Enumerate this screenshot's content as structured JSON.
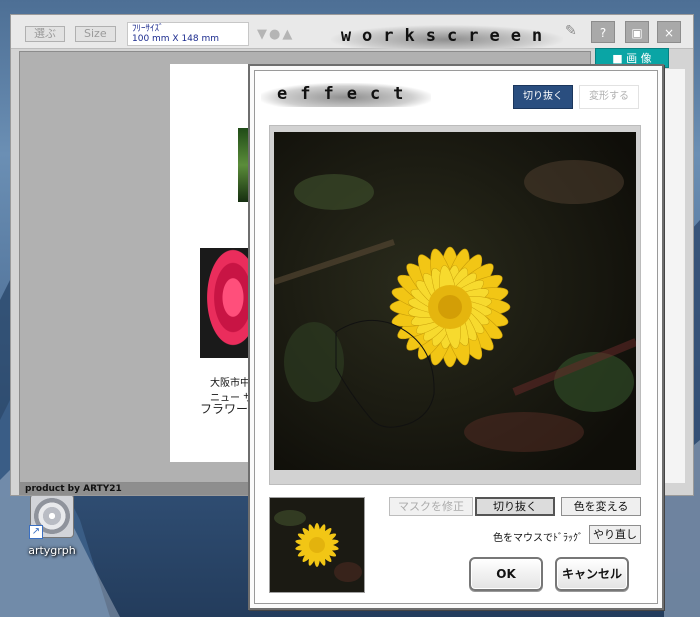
{
  "desktop": {
    "icon_label": "artygrph"
  },
  "workscreen": {
    "select_button": "選ぶ",
    "size_button": "Size",
    "size_info_line1": "ﾌﾘｰｻｲｽﾞ",
    "size_info_line2": "100 mm  X  148 mm",
    "logo": "workscreen",
    "help_button": "?",
    "close_button": "×",
    "image_tab": "■ 画 像",
    "page_caption_1": "大阪市中",
    "page_caption_1b": "ニュー サ",
    "page_caption_2": "フラワー",
    "footer": "product by ARTY21"
  },
  "effect": {
    "logo": "effect",
    "mode_crop": "切り抜く",
    "mode_transform": "変形する",
    "mask_fix_button": "マスクを修正",
    "crop_button": "切り抜く",
    "change_color_button": "色を変える",
    "drag_hint": "色をマウスでﾄﾞﾗｯｸﾞ",
    "redo_button": "やり直し",
    "ok_button": "OK",
    "cancel_button": "キャンセル"
  },
  "colors": {
    "accent_teal": "#0aa5a5",
    "active_mode": "#2a4e7f",
    "flower_yellow": "#f5d21e"
  }
}
